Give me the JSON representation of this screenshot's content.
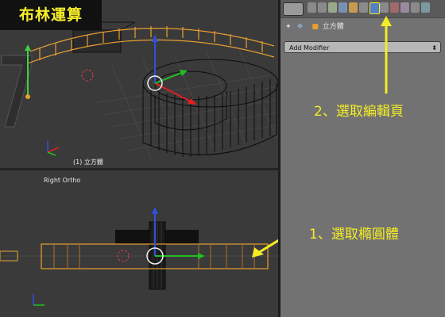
{
  "title_overlay": "布林運算",
  "viewport_top": {
    "object_label": "(1) 立方體"
  },
  "viewport_bottom": {
    "view_label": "Right Ortho"
  },
  "properties_panel": {
    "breadcrumb_object": "立方體",
    "add_modifier_label": "Add Modifier",
    "dropdown_arrow": "⬍",
    "active_tab": "modifiers",
    "tab_icons": [
      "render-icon",
      "render-layers-icon",
      "scene-icon",
      "world-icon",
      "object-icon",
      "constraints-icon",
      "modifiers-icon",
      "data-icon",
      "material-icon",
      "texture-icon",
      "particles-icon",
      "physics-icon"
    ]
  },
  "annotations": {
    "step2": "2、選取編輯頁",
    "step1": "1、選取橢圓體"
  },
  "colors": {
    "title_text": "#f7ef2a",
    "annotation": "#f4ec24",
    "selection_orange": "#e8a030",
    "active_tab_blue": "#5580c8"
  }
}
